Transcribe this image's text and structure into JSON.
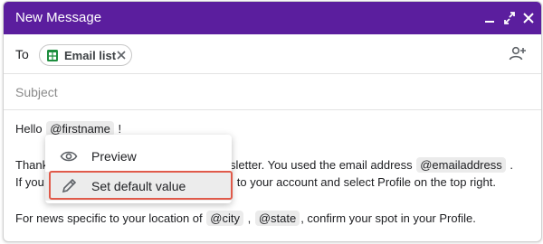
{
  "window": {
    "title": "New Message"
  },
  "header": {
    "to_label": "To",
    "chip_label": "Email list",
    "chip_icon": "google-sheets-icon"
  },
  "subject": {
    "placeholder": "Subject",
    "value": ""
  },
  "body": {
    "line1": {
      "before": "Hello ",
      "tag": "@firstname",
      "after": " !"
    },
    "line2": {
      "before": "Thank",
      "after": "newsletter. You used the email address ",
      "tag": "@emailaddress",
      "end": " ."
    },
    "line3": {
      "before": "If you",
      "after": "to your account and select Profile on the top right."
    },
    "line4": {
      "before": "For news specific to your location of ",
      "tag1": "@city",
      "sep": " , ",
      "tag2": "@state",
      "after": ", confirm your spot in your Profile."
    }
  },
  "context_menu": {
    "items": [
      {
        "label": "Preview",
        "icon": "eye-icon"
      },
      {
        "label": "Set default value",
        "icon": "pencil-icon"
      }
    ],
    "highlighted_item": "Set default value"
  },
  "colors": {
    "titlebar": "#5b1e9e",
    "highlight": "#e05a4a"
  }
}
